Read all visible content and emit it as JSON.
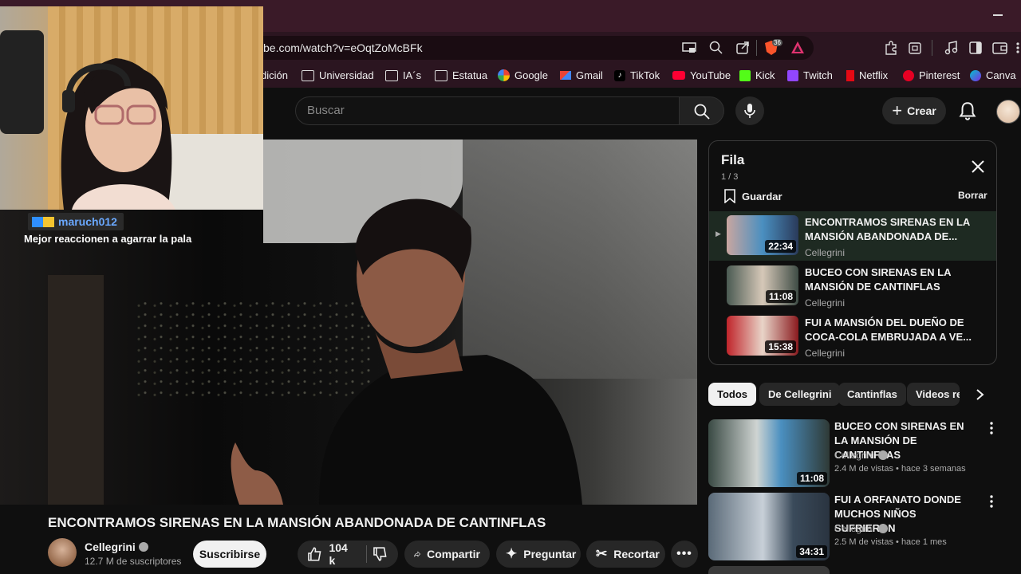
{
  "browser": {
    "url": "be.com/watch?v=eOqtZoMcBFk",
    "brave_badge": "36",
    "bookmarks": [
      "dición",
      "Universidad",
      "IA´s",
      "Estatua",
      "Google",
      "Gmail",
      "TikTok",
      "YouTube",
      "Kick",
      "Twitch",
      "Netflix",
      "Pinterest",
      "Canva"
    ]
  },
  "youtube": {
    "search_placeholder": "Buscar",
    "create_label": "Crear"
  },
  "stream_overlay": {
    "chat_username": "maruch012",
    "chat_message": "Mejor reaccionen a agarrar la pala"
  },
  "video": {
    "title": "ENCONTRAMOS SIRENAS EN LA MANSIÓN ABANDONADA DE CANTINFLAS",
    "channel": "Cellegrini",
    "subscribers": "12.7 M de suscriptores",
    "subscribe_label": "Suscribirse",
    "likes": "104 k",
    "share_label": "Compartir",
    "ask_label": "Preguntar",
    "clip_label": "Recortar"
  },
  "queue": {
    "title": "Fila",
    "position": "1 / 3",
    "save_label": "Guardar",
    "clear_label": "Borrar",
    "items": [
      {
        "title": "ENCONTRAMOS SIRENAS EN LA MANSIÓN ABANDONADA DE...",
        "channel": "Cellegrini",
        "duration": "22:34"
      },
      {
        "title": "BUCEO CON SIRENAS EN LA MANSIÓN DE CANTINFLAS",
        "channel": "Cellegrini",
        "duration": "11:08"
      },
      {
        "title": "FUI A MANSIÓN DEL DUEÑO DE COCA-COLA EMBRUJADA A VE...",
        "channel": "Cellegrini",
        "duration": "15:38"
      }
    ]
  },
  "chips": [
    "Todos",
    "De Cellegrini",
    "Cantinflas",
    "Videos re"
  ],
  "recommendations": [
    {
      "title": "BUCEO CON SIRENAS EN LA MANSIÓN DE CANTINFLAS",
      "channel": "Cellegrini",
      "meta": "2.4 M de vistas • hace 3 semanas",
      "duration": "11:08"
    },
    {
      "title": "FUI A ORFANATO DONDE MUCHOS NIÑOS SUFRIERON",
      "channel": "Cellegrini",
      "meta": "2.5 M de vistas • hace 1 mes",
      "duration": "34:31"
    }
  ],
  "colors": {
    "accent_red": "#ff0033",
    "background": "#0f0f0f",
    "titlebar": "#3a1a28"
  }
}
